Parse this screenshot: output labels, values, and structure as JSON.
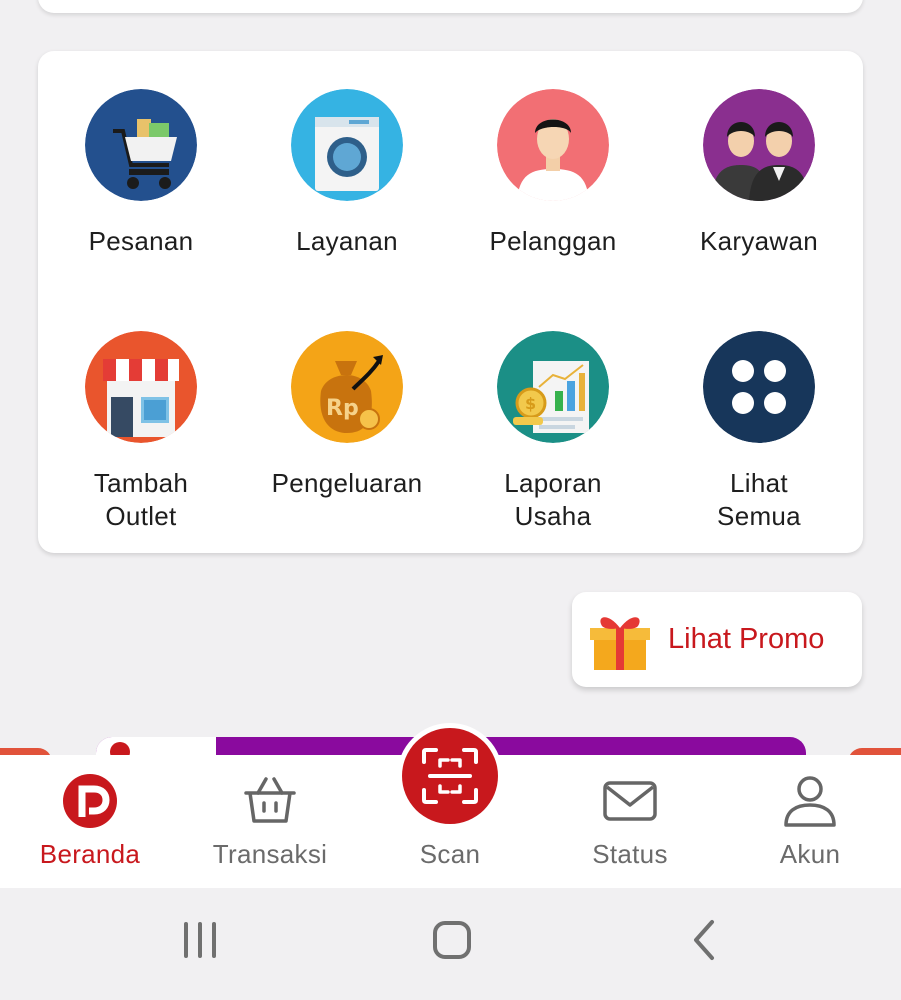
{
  "menu": {
    "items": [
      {
        "label": "Pesanan",
        "icon": "shopping-cart-icon"
      },
      {
        "label": "Layanan",
        "icon": "washing-machine-icon"
      },
      {
        "label": "Pelanggan",
        "icon": "customer-icon"
      },
      {
        "label": "Karyawan",
        "icon": "employees-icon"
      },
      {
        "label": "Tambah\nOutlet",
        "icon": "store-icon"
      },
      {
        "label": "Pengeluaran",
        "icon": "money-bag-icon"
      },
      {
        "label": "Laporan\nUsaha",
        "icon": "report-icon"
      },
      {
        "label": "Lihat\nSemua",
        "icon": "grid-dots-icon"
      }
    ]
  },
  "promo": {
    "label": "Lihat Promo",
    "icon": "gift-icon"
  },
  "bottom_nav": {
    "items": [
      {
        "label": "Beranda",
        "icon": "home-logo-icon",
        "active": true
      },
      {
        "label": "Transaksi",
        "icon": "basket-icon",
        "active": false
      },
      {
        "label": "Scan",
        "icon": "scan-icon",
        "active": false
      },
      {
        "label": "Status",
        "icon": "mail-icon",
        "active": false
      },
      {
        "label": "Akun",
        "icon": "user-icon",
        "active": false
      }
    ]
  },
  "colors": {
    "accent": "#c8181d",
    "background": "#f1f0f2",
    "card": "#ffffff",
    "inactive": "#6b6b6b",
    "banner": "#8a0a9e"
  },
  "system_nav": {
    "buttons": [
      "recent-apps-icon",
      "home-icon",
      "back-icon"
    ]
  }
}
